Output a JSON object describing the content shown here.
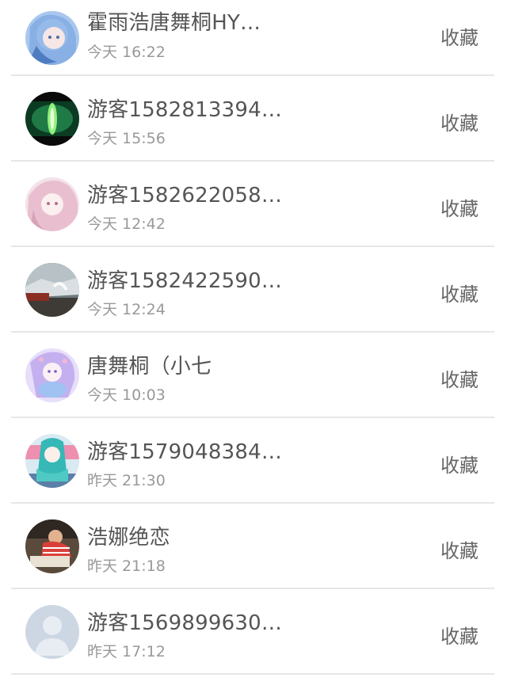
{
  "items": [
    {
      "name": "霍雨浩唐舞桐HY…",
      "time": "今天 16:22",
      "action": "收藏",
      "avatar": "anime-avatar-icon"
    },
    {
      "name": "游客1582813394…",
      "time": "今天 15:56",
      "action": "收藏",
      "avatar": "green-glow-avatar-icon"
    },
    {
      "name": "游客1582622058…",
      "time": "今天 12:42",
      "action": "收藏",
      "avatar": "pink-anime-avatar-icon"
    },
    {
      "name": "游客1582422590…",
      "time": "今天 12:24",
      "action": "收藏",
      "avatar": "photo-avatar-icon"
    },
    {
      "name": "唐舞桐（小七",
      "time": "今天 10:03",
      "action": "收藏",
      "avatar": "purple-anime-avatar-icon"
    },
    {
      "name": "游客1579048384…",
      "time": "昨天 21:30",
      "action": "收藏",
      "avatar": "teal-anime-avatar-icon"
    },
    {
      "name": "浩娜绝恋",
      "time": "昨天 21:18",
      "action": "收藏",
      "avatar": "child-photo-avatar-icon"
    },
    {
      "name": "游客1569899630…",
      "time": "昨天 17:12",
      "action": "收藏",
      "avatar": "default-person-avatar-icon"
    }
  ]
}
